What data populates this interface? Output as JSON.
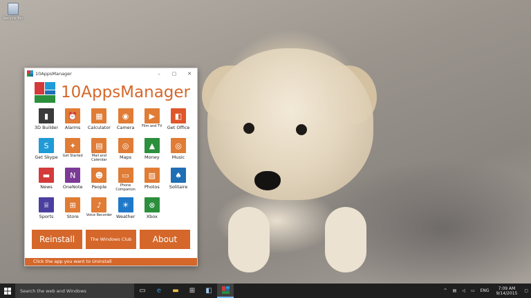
{
  "desktop": {
    "recycle_bin_label": "Recycle Bin"
  },
  "window": {
    "title": "10AppsManager",
    "minimize": "–",
    "maximize": "▢",
    "close": "✕"
  },
  "header": {
    "title": "10AppsManager"
  },
  "apps": [
    {
      "label": "3D Builder",
      "icon": "cube-icon",
      "glyph": "▮",
      "color": "#3b3b3b"
    },
    {
      "label": "Alarms",
      "icon": "alarm-clock-icon",
      "glyph": "⏰",
      "color": "#e07c35"
    },
    {
      "label": "Calculator",
      "icon": "calculator-icon",
      "glyph": "▦",
      "color": "#e07c35"
    },
    {
      "label": "Camera",
      "icon": "camera-icon",
      "glyph": "◉",
      "color": "#e07c35"
    },
    {
      "label": "Film and TV",
      "icon": "film-icon",
      "glyph": "▶",
      "color": "#e07c35",
      "small": true
    },
    {
      "label": "Get Office",
      "icon": "office-icon",
      "glyph": "◧",
      "color": "#e0552a"
    },
    {
      "label": "Get Skype",
      "icon": "skype-icon",
      "glyph": "S",
      "color": "#1f9bd7"
    },
    {
      "label": "Get Started",
      "icon": "lightbulb-icon",
      "glyph": "✦",
      "color": "#e07c35",
      "small": true
    },
    {
      "label": "Mail and Calendar",
      "icon": "calendar-icon",
      "glyph": "▤",
      "color": "#e07c35",
      "small": true
    },
    {
      "label": "Maps",
      "icon": "map-pin-icon",
      "glyph": "◎",
      "color": "#e07c35"
    },
    {
      "label": "Money",
      "icon": "money-chart-icon",
      "glyph": "▲",
      "color": "#2b8f3c"
    },
    {
      "label": "Music",
      "icon": "music-disc-icon",
      "glyph": "◎",
      "color": "#e07c35"
    },
    {
      "label": "News",
      "icon": "news-icon",
      "glyph": "▬",
      "color": "#d43a3a"
    },
    {
      "label": "OneNote",
      "icon": "onenote-icon",
      "glyph": "N",
      "color": "#7b3a96"
    },
    {
      "label": "People",
      "icon": "people-icon",
      "glyph": "☻",
      "color": "#e07c35"
    },
    {
      "label": "Phone Companion",
      "icon": "phone-icon",
      "glyph": "▭",
      "color": "#e07c35",
      "small": true
    },
    {
      "label": "Photos",
      "icon": "photos-icon",
      "glyph": "▨",
      "color": "#e07c35"
    },
    {
      "label": "Solitaire",
      "icon": "cards-icon",
      "glyph": "♠",
      "color": "#1f6fb5"
    },
    {
      "label": "Sports",
      "icon": "trophy-icon",
      "glyph": "♕",
      "color": "#4b3fa0"
    },
    {
      "label": "Store",
      "icon": "store-bag-icon",
      "glyph": "⊞",
      "color": "#e07c35"
    },
    {
      "label": "Voice Recorder",
      "icon": "microphone-icon",
      "glyph": "♪",
      "color": "#e07c35",
      "small": true
    },
    {
      "label": "Weather",
      "icon": "weather-sun-icon",
      "glyph": "☀",
      "color": "#1f78c8"
    },
    {
      "label": "Xbox",
      "icon": "xbox-icon",
      "glyph": "⊗",
      "color": "#2b8f3c"
    }
  ],
  "buttons": {
    "reinstall": "Reinstall",
    "club": "The Windows Club",
    "about": "About"
  },
  "status": "Click the app you want to Uninstall",
  "taskbar": {
    "search_placeholder": "Search the web and Windows",
    "language": "ENG",
    "time": "7:09 AM",
    "date": "9/14/2015"
  }
}
